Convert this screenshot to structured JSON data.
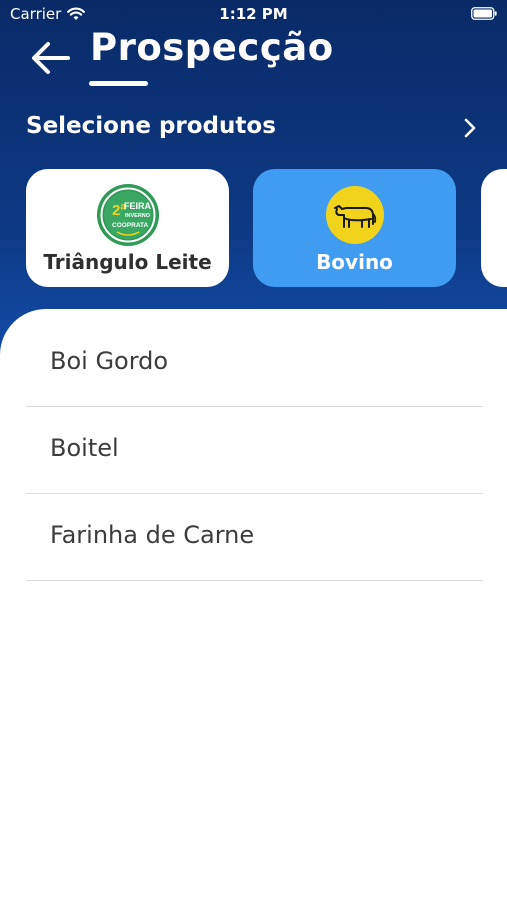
{
  "status_bar": {
    "carrier": "Carrier",
    "time": "1:12 PM"
  },
  "header": {
    "title": "Prospecção",
    "back_icon": "arrow-left-icon"
  },
  "section": {
    "title": "Selecione produtos",
    "chevron_icon": "chevron-right-icon"
  },
  "products": [
    {
      "label": "Triângulo Leite",
      "icon": "feira-inverno-logo",
      "selected": false,
      "logo_text": [
        "2ª",
        "FEIRA",
        "INVERNO",
        "COOPRATA"
      ]
    },
    {
      "label": "Bovino",
      "icon": "cow-icon",
      "selected": true
    },
    {
      "label": "",
      "icon": "",
      "selected": false
    }
  ],
  "list": {
    "items": [
      {
        "label": "Boi Gordo"
      },
      {
        "label": "Boitel"
      },
      {
        "label": "Farinha de Carne"
      }
    ]
  },
  "colors": {
    "header_top": "#0a2a66",
    "header_bottom": "#1755b8",
    "selected_card": "#3f9cf0",
    "cow_badge": "#f2d31b",
    "logo_green": "#2e9a55"
  }
}
